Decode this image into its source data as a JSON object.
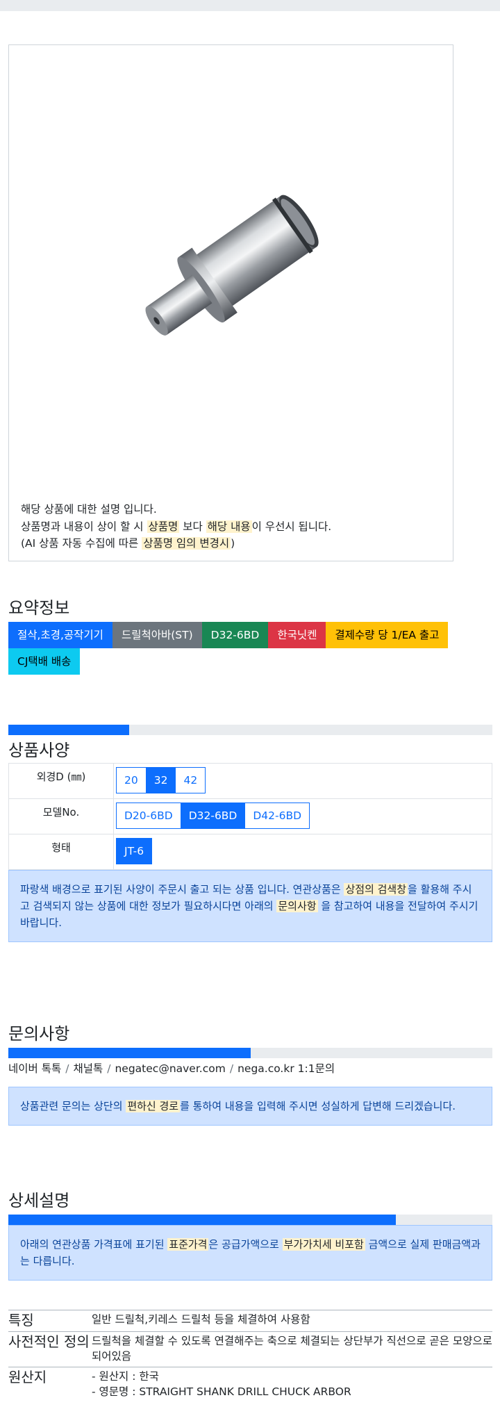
{
  "image_caption": {
    "line1": "해당 상품에 대한 설명 입니다.",
    "line2_a": "상품명과 내용이 상이 할 시 ",
    "line2_hl1": "상품명",
    "line2_b": " 보다 ",
    "line2_hl2": "해당 내용",
    "line2_c": "이 우선시 됩니다.",
    "line3_a": "(AI 상품 자동 수집에 따른 ",
    "line3_hl": "상품명 임의 변경시",
    "line3_b": ")"
  },
  "summary": {
    "title": "요약정보",
    "badges": [
      "절삭,초경,공작기기",
      "드릴척아바(ST)",
      "D32-6BD",
      "한국닛켄",
      "결제수량 당 1/EA 출고",
      "CJ택배 배송"
    ]
  },
  "spec": {
    "title": "상품사양",
    "progress": 0.25,
    "rows": [
      {
        "label": "외경D (㎜)",
        "options": [
          "20",
          "32",
          "42"
        ],
        "active": 1
      },
      {
        "label": "모델No.",
        "options": [
          "D20-6BD",
          "D32-6BD",
          "D42-6BD"
        ],
        "active": 1
      },
      {
        "label": "형태",
        "options": [
          "JT-6"
        ],
        "active": 0
      }
    ],
    "notice_a": "파랑색 배경으로 표기된 사양이 주문시 출고 되는 상품 입니다. 연관상품은 ",
    "notice_hl1": "상점의 검색창",
    "notice_b": "을 활용해 주시고 검색되지 않는 상품에 대한 정보가 필요하시다면 아래의 ",
    "notice_hl2": "문의사항",
    "notice_c": " 을 참고하여 내용을 전달하여 주시기 바랍니다."
  },
  "inquiry": {
    "title": "문의사항",
    "progress": 0.5,
    "contacts": [
      "네이버 톡톡",
      "채널톡",
      "negatec@naver.com",
      "nega.co.kr 1:1문의"
    ],
    "separator": "/",
    "notice_a": "상품관련 문의는 상단의 ",
    "notice_hl": "편하신 경로",
    "notice_b": "를 통하여 내용을 입력해 주시면 성실하게 답변해 드리겠습니다."
  },
  "detail": {
    "title": "상세설명",
    "progress": 0.8,
    "notice_a": "아래의 연관상품 가격표에 표기된 ",
    "notice_hl1": "표준가격",
    "notice_b": "은 공급가액으로 ",
    "notice_hl2": "부가가치세 비포함",
    "notice_c": " 금액으로 실제 판매금액과는 다릅니다.",
    "rows": [
      {
        "key": "특징",
        "value": "일반 드릴척,키레스 드릴척 등을 체결하여 사용함"
      },
      {
        "key": "사전적인 정의",
        "value": "드릴척을 체결할 수 있도록 연결해주는 축으로 체결되는 상단부가 직선으로 곧은 모양으로 되어있음"
      },
      {
        "key": "원산지",
        "value_lines": [
          "- 원산지 : 한국",
          "- 영문명 : STRAIGHT SHANK DRILL CHUCK ARBOR"
        ]
      }
    ]
  },
  "colors": {
    "primary": "#0d6efd",
    "highlight": "#fff3cd",
    "alert_bg": "#cfe2ff"
  }
}
